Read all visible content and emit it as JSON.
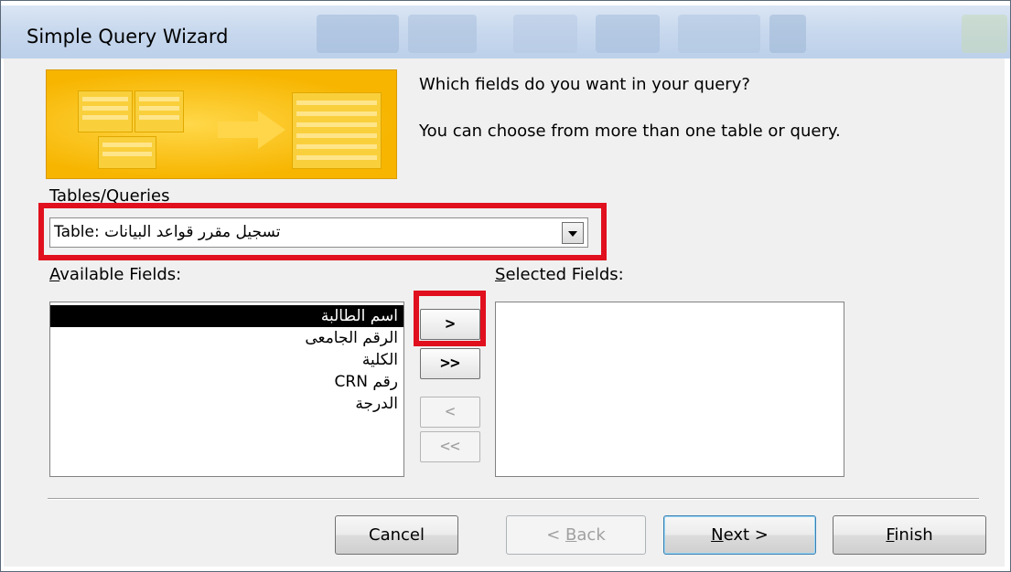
{
  "window": {
    "title": "Simple Query Wizard"
  },
  "intro": {
    "line1": "Which fields do you want in your query?",
    "line2": "You can choose from more than one table or query."
  },
  "tables_queries": {
    "label": "Tables/Queries",
    "selected": "Table: تسجيل مقرر قواعد البيانات"
  },
  "available_fields": {
    "label_first": "A",
    "label_rest": "vailable Fields:",
    "items": [
      "اسم الطالبة",
      "الرقم الجامعى",
      "الكلية",
      "رقم CRN",
      "الدرجة"
    ],
    "selected_index": 0
  },
  "selected_fields": {
    "label_first": "S",
    "label_rest": "elected Fields:",
    "items": []
  },
  "move_buttons": {
    "add_one": ">",
    "add_all": ">>",
    "remove_one": "<",
    "remove_all": "<<"
  },
  "footer": {
    "cancel": "Cancel",
    "back_prefix": "< ",
    "back_key": "B",
    "back_rest": "ack",
    "next_key": "N",
    "next_rest": "ext >",
    "finish_key": "F",
    "finish_rest": "inish"
  },
  "colors": {
    "highlight": "#e1101e",
    "banner": "#f6b400",
    "dialog_bg": "#f0f0f0"
  }
}
